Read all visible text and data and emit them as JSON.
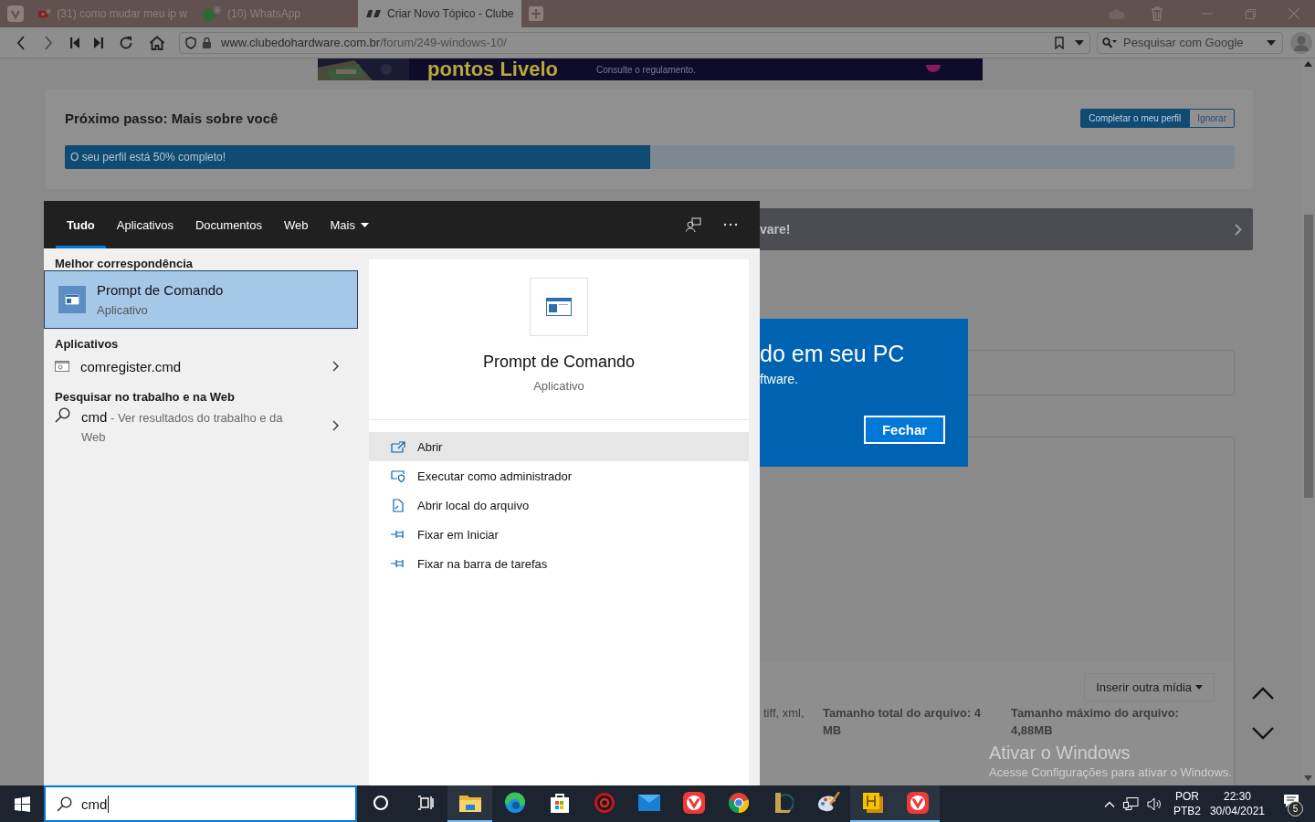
{
  "browser": {
    "tabs": [
      {
        "title": "(31) como mudar meu ip w",
        "kind": "video",
        "selected": false
      },
      {
        "title": "(10) WhatsApp",
        "kind": "chat",
        "selected": false
      },
      {
        "title": "Criar Novo Tópico - Clube",
        "kind": "site",
        "selected": true
      }
    ],
    "address": {
      "domain": "www.clubedohardware.com.br",
      "path": "/forum/249-windows-10/"
    },
    "search_field": {
      "placeholder": "Pesquisar com Google"
    }
  },
  "page": {
    "banner": {
      "headline": "pontos Livelo",
      "note": "Consulte o regulamento."
    },
    "profile_card": {
      "title": "Próximo passo: Mais sobre você",
      "buttons": [
        "Completar o meu perfil",
        "Ignorar"
      ],
      "progress": {
        "label": "O seu perfil está 50% completo!",
        "level": 0.5
      }
    },
    "notice_bar": {
      "text": "vare!"
    },
    "dialog": {
      "title": "do em seu PC",
      "text": "ftware.",
      "button": "Fechar"
    },
    "editor": {
      "media_button": "Inserir outra mídia",
      "file_types": "tiff, xml,",
      "total_size": "Tamanho total do arquivo: 4 MB",
      "max_size": "Tamanho máximo do arquivo: 4,88MB"
    }
  },
  "start_search": {
    "tabs": [
      {
        "label": "Tudo",
        "kind": "plain",
        "selected": true
      },
      {
        "label": "Aplicativos",
        "kind": "plain",
        "selected": false
      },
      {
        "label": "Documentos",
        "kind": "plain",
        "selected": false
      },
      {
        "label": "Web",
        "kind": "plain",
        "selected": false
      },
      {
        "label": "Mais",
        "kind": "dropdown",
        "selected": false
      }
    ],
    "sections": [
      {
        "heading": "Melhor correspondência",
        "items": [
          {
            "kind": "best",
            "title": "Prompt de Comando",
            "subtitle": "Aplicativo",
            "selected": true
          }
        ]
      },
      {
        "heading": "Aplicativos",
        "items": [
          {
            "kind": "app",
            "title": "comregister.cmd",
            "selected": false
          }
        ]
      },
      {
        "heading": "Pesquisar no trabalho e na Web",
        "items": [
          {
            "kind": "web",
            "title": "cmd",
            "subtitle": "- Ver resultados do trabalho e da Web",
            "selected": false
          }
        ]
      }
    ],
    "preview": {
      "title": "Prompt de Comando",
      "subtitle": "Aplicativo",
      "actions": [
        {
          "label": "Abrir",
          "kind": "open",
          "selected": true
        },
        {
          "label": "Executar como administrador",
          "kind": "admin",
          "selected": false
        },
        {
          "label": "Abrir local do arquivo",
          "kind": "folder",
          "selected": false
        },
        {
          "label": "Fixar em Iniciar",
          "kind": "pin",
          "selected": false
        },
        {
          "label": "Fixar na barra de tarefas",
          "kind": "pin",
          "selected": false
        }
      ]
    },
    "query": "cmd"
  },
  "taskbar": {
    "apps": [
      {
        "kind": "cortana",
        "running": false
      },
      {
        "kind": "taskview",
        "running": false
      },
      {
        "kind": "explorer",
        "running": true
      },
      {
        "kind": "edge",
        "running": false
      },
      {
        "kind": "store",
        "running": false
      },
      {
        "kind": "game",
        "running": false
      },
      {
        "kind": "mail",
        "running": false
      },
      {
        "kind": "vivaldi",
        "running": false
      },
      {
        "kind": "chrome",
        "running": false
      },
      {
        "kind": "league",
        "running": false
      },
      {
        "kind": "paint",
        "running": false
      },
      {
        "kind": "notes",
        "running": true
      },
      {
        "kind": "vivaldi",
        "running": true
      }
    ],
    "tray": {
      "language": "POR",
      "layout": "PTB2",
      "time": "22:30",
      "date": "30/04/2021",
      "notifications": "5"
    }
  },
  "watermark": {
    "title": "Ativar o Windows",
    "text": "Acesse Configurações para ativar o Windows."
  }
}
